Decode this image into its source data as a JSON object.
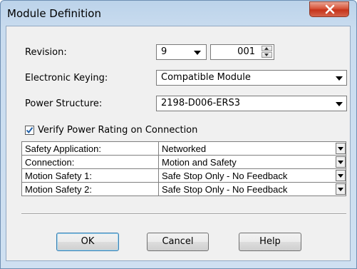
{
  "window": {
    "title": "Module Definition"
  },
  "revision": {
    "label": "Revision:",
    "major": "9",
    "minor": "001"
  },
  "electronic_keying": {
    "label": "Electronic Keying:",
    "value": "Compatible Module"
  },
  "power_structure": {
    "label": "Power Structure:",
    "value": "2198-D006-ERS3"
  },
  "verify_power": {
    "label": "Verify Power Rating on Connection",
    "checked": true
  },
  "grid": {
    "rows": [
      {
        "name": "Safety Application:",
        "value": "Networked"
      },
      {
        "name": "Connection:",
        "value": "Motion and Safety"
      },
      {
        "name": "Motion Safety 1:",
        "value": "Safe Stop Only - No Feedback"
      },
      {
        "name": "Motion Safety 2:",
        "value": "Safe Stop Only - No Feedback"
      }
    ]
  },
  "buttons": {
    "ok": "OK",
    "cancel": "Cancel",
    "help": "Help"
  },
  "icons": {
    "close": "close-icon",
    "check": "checkmark-icon",
    "dropdown": "chevron-down-icon",
    "spin_up": "spin-up-icon",
    "spin_down": "spin-down-icon"
  },
  "colors": {
    "titlebar": "#bcd3ea",
    "close_button": "#c5331a",
    "checkmark": "#1f5fa8"
  }
}
